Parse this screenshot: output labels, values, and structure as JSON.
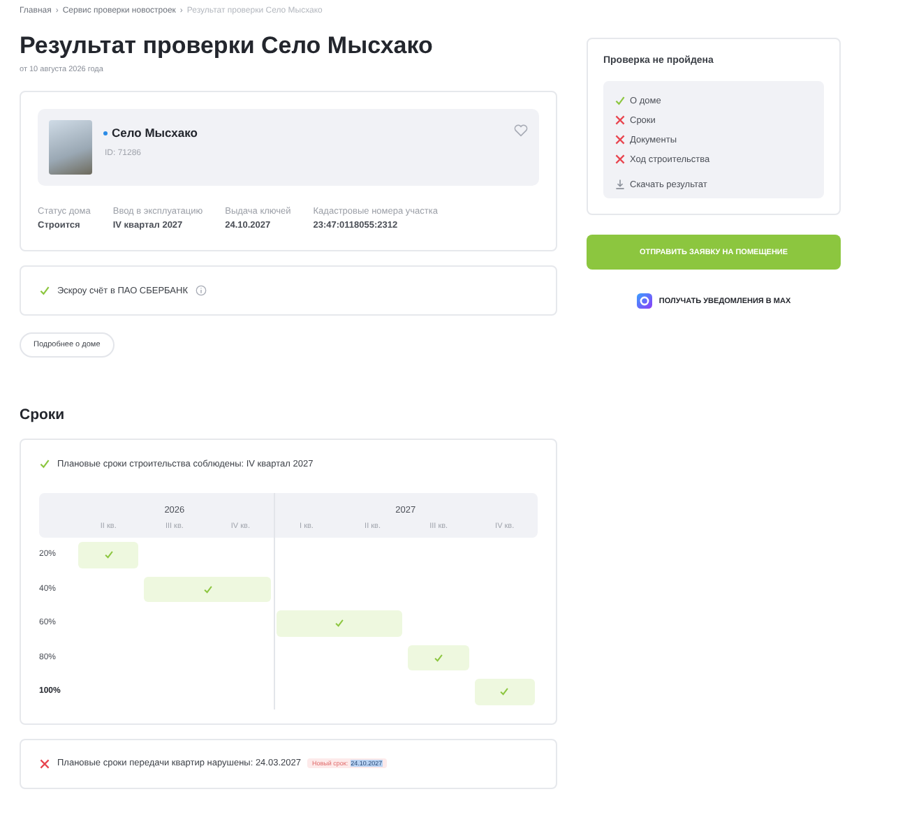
{
  "breadcrumbs": [
    {
      "label": "Главная",
      "current": false
    },
    {
      "label": "Сервис проверки новостроек",
      "current": false
    },
    {
      "label": "Результат проверки Село Мысхако",
      "current": true
    }
  ],
  "breadcrumb_separator": "›",
  "title": "Результат проверки Село Мысхако",
  "date": "от 10 августа 2026 года",
  "house": {
    "name": "Село Мысхако",
    "id": "ID: 71286",
    "favorite": false,
    "facts": [
      {
        "label": "Статус дома",
        "value": "Строится"
      },
      {
        "label": "Ввод в эксплуатацию",
        "value": "IV квартал 2027"
      },
      {
        "label": "Выдача ключей",
        "value": "24.10.2027"
      },
      {
        "label": "Кадастровые номера участка",
        "value": "23:47:0118055:2312"
      }
    ]
  },
  "escrow": {
    "passed": true,
    "text": "Эскроу счёт в ПАО СБЕРБАНК"
  },
  "details_button": "Подробнее о доме",
  "sidebar": {
    "title": "Проверка не пройдена",
    "checks": [
      {
        "label": "О доме",
        "passed": true
      },
      {
        "label": "Сроки",
        "passed": false
      },
      {
        "label": "Документы",
        "passed": false
      },
      {
        "label": "Ход строительства",
        "passed": false
      }
    ],
    "download": "Скачать результат",
    "submit_button": "ОТПРАВИТЬ ЗАЯВКУ НА ПОМЕЩЕНИЕ",
    "notify_link": "ПОЛУЧАТЬ УВЕДОМЛЕНИЯ В MAX"
  },
  "deadlines": {
    "heading": "Сроки",
    "construction": {
      "passed": true,
      "text": "Плановые сроки строительства соблюдены: IV квартал 2027"
    },
    "years": [
      {
        "label": "2026",
        "quarters": [
          "II кв.",
          "III кв.",
          "IV кв."
        ]
      },
      {
        "label": "2027",
        "quarters": [
          "I кв.",
          "II кв.",
          "III кв.",
          "IV кв."
        ]
      }
    ],
    "rows": [
      {
        "label": "20%",
        "final": false,
        "cells": [
          true,
          false,
          false,
          false,
          false,
          false,
          false
        ]
      },
      {
        "label": "40%",
        "final": false,
        "cells": [
          false,
          true,
          true,
          false,
          false,
          false,
          false
        ]
      },
      {
        "label": "60%",
        "final": false,
        "cells": [
          false,
          false,
          false,
          true,
          true,
          false,
          false
        ]
      },
      {
        "label": "80%",
        "final": false,
        "cells": [
          false,
          false,
          false,
          false,
          false,
          true,
          false
        ]
      },
      {
        "label": "100%",
        "final": true,
        "cells": [
          false,
          false,
          false,
          false,
          false,
          false,
          true
        ]
      }
    ],
    "handover": {
      "passed": false,
      "text": "Плановые сроки передачи квартир нарушены: 24.03.2027",
      "new_label": "Новый срок:",
      "new_date": "24.10.2027"
    }
  }
}
